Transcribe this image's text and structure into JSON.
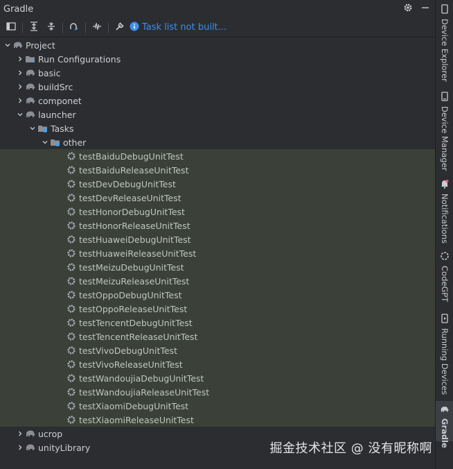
{
  "header": {
    "title": "Gradle"
  },
  "toolbar": {
    "info_text": "Task list not built..."
  },
  "tree": {
    "project": "Project",
    "nodes": [
      {
        "label": "Run Configurations"
      },
      {
        "label": "basic"
      },
      {
        "label": "buildSrc"
      },
      {
        "label": "componet"
      },
      {
        "label": "launcher"
      }
    ],
    "tasks_label": "Tasks",
    "other_label": "other",
    "tasks": [
      "testBaiduDebugUnitTest",
      "testBaiduReleaseUnitTest",
      "testDevDebugUnitTest",
      "testDevReleaseUnitTest",
      "testHonorDebugUnitTest",
      "testHonorReleaseUnitTest",
      "testHuaweiDebugUnitTest",
      "testHuaweiReleaseUnitTest",
      "testMeizuDebugUnitTest",
      "testMeizuReleaseUnitTest",
      "testOppoDebugUnitTest",
      "testOppoReleaseUnitTest",
      "testTencentDebugUnitTest",
      "testTencentReleaseUnitTest",
      "testVivoDebugUnitTest",
      "testVivoReleaseUnitTest",
      "testWandoujiaDebugUnitTest",
      "testWandoujiaReleaseUnitTest",
      "testXiaomiDebugUnitTest",
      "testXiaomiReleaseUnitTest"
    ],
    "tail": [
      {
        "label": "ucrop"
      },
      {
        "label": "unityLibrary"
      }
    ]
  },
  "sidebar": {
    "tabs": [
      {
        "label": "Device Explorer"
      },
      {
        "label": "Device Manager"
      },
      {
        "label": "Notifications"
      },
      {
        "label": "CodeGPT"
      },
      {
        "label": "Running Devices"
      },
      {
        "label": "Gradle"
      }
    ]
  },
  "watermark": "掘金技术社区 @ 没有昵称啊",
  "colors": {
    "background": "#2b2d30",
    "selection": "#3b4039",
    "link": "#3d8ef0"
  }
}
